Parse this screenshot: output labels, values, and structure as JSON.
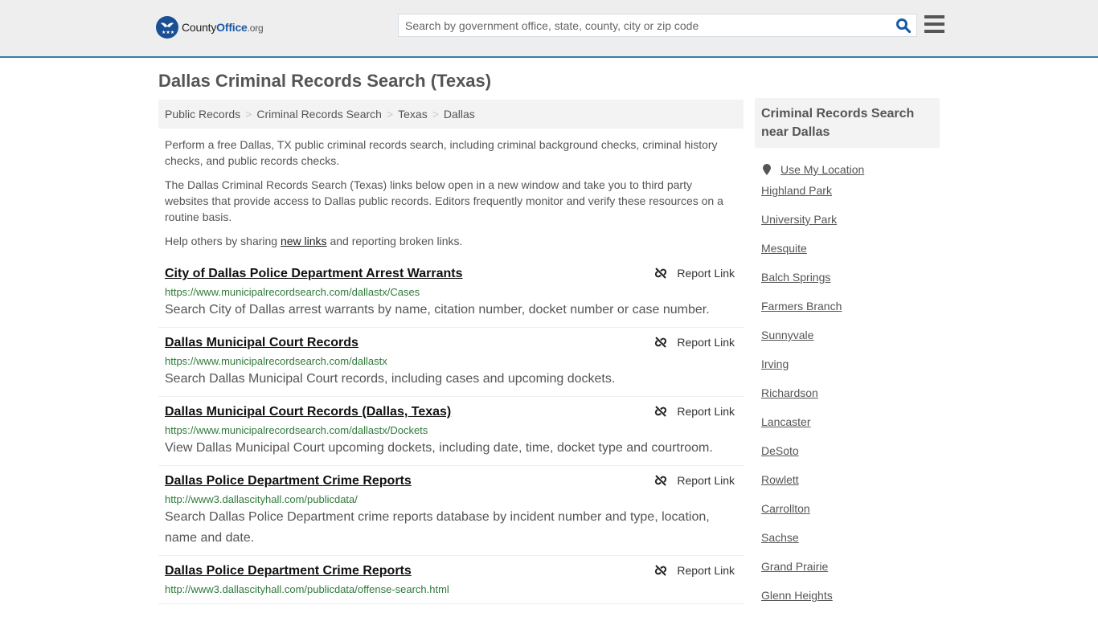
{
  "header": {
    "logo": {
      "brand_first": "County",
      "brand_second": "Office",
      "brand_tld": ".org"
    },
    "search": {
      "placeholder": "Search by government office, state, county, city or zip code",
      "value": ""
    },
    "icons": {
      "search": "search-icon",
      "menu": "hamburger-menu-icon"
    },
    "accent_color": "#3a7cad"
  },
  "page": {
    "title": "Dallas Criminal Records Search (Texas)",
    "breadcrumb": [
      "Public Records",
      "Criminal Records Search",
      "Texas",
      "Dallas"
    ],
    "breadcrumb_separator": ">",
    "intro": {
      "p1": "Perform a free Dallas, TX public criminal records search, including criminal background checks, criminal history checks, and public records checks.",
      "p2": "The Dallas Criminal Records Search (Texas) links below open in a new window and take you to third party websites that provide access to Dallas public records. Editors frequently monitor and verify these resources on a routine basis.",
      "p3_before": "Help others by sharing ",
      "p3_link": "new links",
      "p3_after": " and reporting broken links."
    },
    "report_label": "Report Link",
    "results": [
      {
        "title": "City of Dallas Police Department Arrest Warrants",
        "url": "https://www.municipalrecordsearch.com/dallastx/Cases",
        "description": "Search City of Dallas arrest warrants by name, citation number, docket number or case number."
      },
      {
        "title": "Dallas Municipal Court Records",
        "url": "https://www.municipalrecordsearch.com/dallastx",
        "description": "Search Dallas Municipal Court records, including cases and upcoming dockets."
      },
      {
        "title": "Dallas Municipal Court Records (Dallas, Texas)",
        "url": "https://www.municipalrecordsearch.com/dallastx/Dockets",
        "description": "View Dallas Municipal Court upcoming dockets, including date, time, docket type and courtroom."
      },
      {
        "title": "Dallas Police Department Crime Reports",
        "url": "http://www3.dallascityhall.com/publicdata/",
        "description": "Search Dallas Police Department crime reports database by incident number and type, location, name and date."
      },
      {
        "title": "Dallas Police Department Crime Reports",
        "url": "http://www3.dallascityhall.com/publicdata/offense-search.html",
        "description": ""
      }
    ]
  },
  "sidebar": {
    "heading": "Criminal Records Search near Dallas",
    "use_location": "Use My Location",
    "cities": [
      "Highland Park",
      "University Park",
      "Mesquite",
      "Balch Springs",
      "Farmers Branch",
      "Sunnyvale",
      "Irving",
      "Richardson",
      "Lancaster",
      "DeSoto",
      "Rowlett",
      "Carrollton",
      "Sachse",
      "Grand Prairie",
      "Glenn Heights"
    ]
  }
}
